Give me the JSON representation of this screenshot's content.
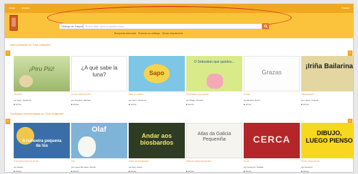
{
  "topbar": {
    "links": [
      "Inicio",
      "Axuda"
    ],
    "user": "Entrar"
  },
  "search": {
    "select_value": "Catalogo de Galipedia",
    "placeholder": "Buscar titulo, autor ou palabra clave",
    "links": [
      "Busqueda avanzada",
      "Explorar ao catalogo",
      "Novas adquisicions"
    ]
  },
  "sections": [
    {
      "title": "Mais prestados no \"Club Galipedia\"",
      "books": [
        {
          "cover_text": "¡Piru Piú!",
          "title": "¡Piru Piú!",
          "author": "por Isern, Susanna",
          "stat": "Libros"
        },
        {
          "cover_text": "¿A qué sabe la luna?",
          "title": "¿A qué sabe la luna?",
          "author": "por Grejniec, Michael",
          "stat": "Libros"
        },
        {
          "cover_text": "Sapo",
          "title": "Sapo e o paxaro",
          "author": "por Isern, Susanna",
          "stat": "Libros"
        },
        {
          "cover_text": "O Sebastian que quedou...",
          "title": "O Sebastian que quedou",
          "author": "por Diago, Antonio",
          "stat": "Libros"
        },
        {
          "cover_text": "Grazas",
          "title": "Grazas",
          "author": "por Bechar, Rocío",
          "stat": "Libros"
        },
        {
          "cover_text": "¡Iriña Bailarina",
          "title": "Iriña bailarina",
          "author": "por Lopez, Cristina",
          "stat": "Libros"
        }
      ]
    },
    {
      "title": "Novidades recomendadas no \"Club Galipedia\"",
      "books": [
        {
          "cover_text": "A ramoeira pequena da lúa",
          "title": "A ramoeira pequena da lúa",
          "author": "por Navas",
          "stat": "Libros"
        },
        {
          "cover_text": "Olaf",
          "title": "Olaf",
          "author": "por Lopez Bernabe, Daniel",
          "stat": "Libros"
        },
        {
          "cover_text": "Andar aos biosbardos",
          "title": "Andar aos biosbardos",
          "author": "por Rey, Arturo",
          "stat": "Libros"
        },
        {
          "cover_text": "Atlas da Galicia Pequeniña",
          "title": "Atlas da Galicia Pequeniña",
          "author": "",
          "stat": "Libros"
        },
        {
          "cover_text": "CERCA",
          "title": "Cerca",
          "author": "por Gutierrez, Natalia",
          "stat": "Libros"
        },
        {
          "cover_text": "DIBUJO, LUEGO PIENSO",
          "title": "Dibujo, luego pienso",
          "author": "por Ascenso",
          "stat": "Libros"
        }
      ]
    }
  ],
  "colors": {
    "topbar": "#f0a81e",
    "header": "#fbc33b",
    "accent": "#e0851c",
    "highlight_ring": "#e02020"
  },
  "icons": {
    "search_button": "magnifier-icon",
    "prev": "chevron-left-icon",
    "next": "chevron-right-icon",
    "stat": "book-icon"
  }
}
